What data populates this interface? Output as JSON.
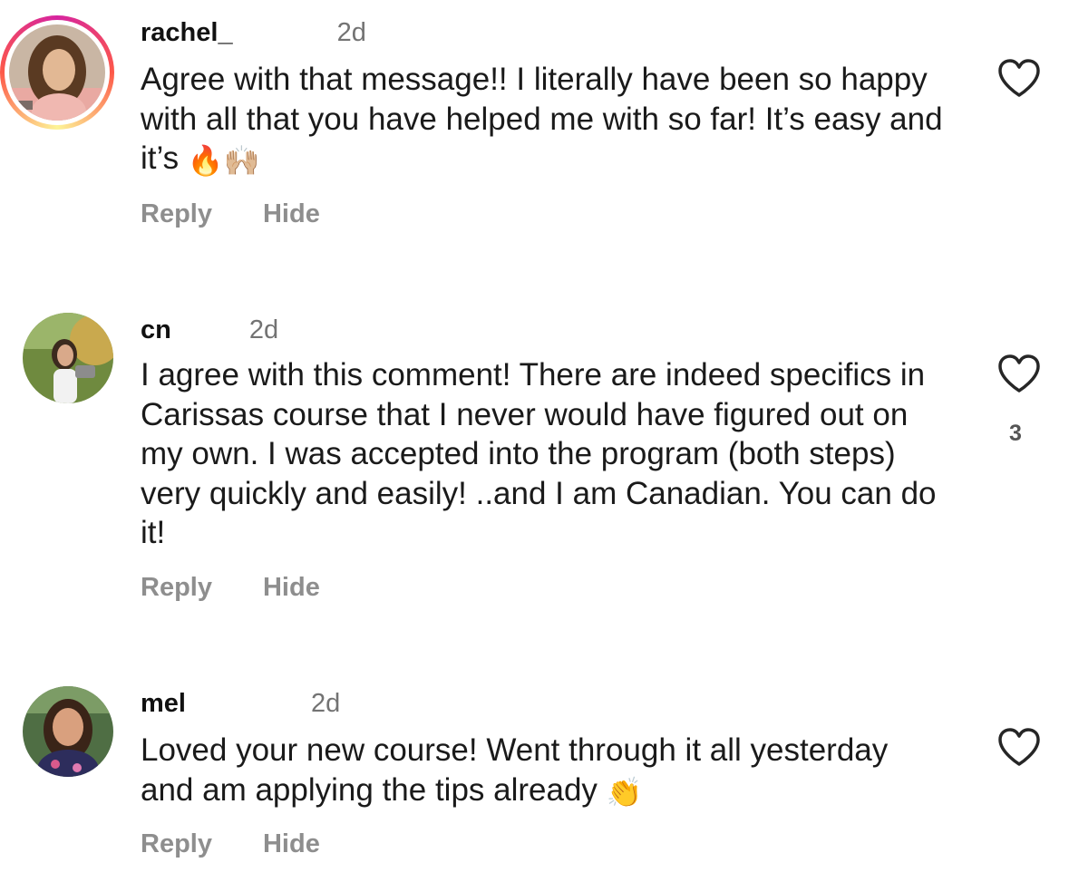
{
  "comments": [
    {
      "username_start": "rachel_",
      "username_end": "",
      "time": "2d",
      "text": "Agree with that message!! I literally have been so happy with all that you have helped me with so far! It’s easy and it’s",
      "emojis": "🔥🙌🏼",
      "reply_label": "Reply",
      "hide_label": "Hide",
      "likes": ""
    },
    {
      "username_start": "cn",
      "username_end": "",
      "time": "2d",
      "text": "I agree with this comment! There are indeed specifics in Carissas course that I never would have figured out on my own. I was accepted into the program (both steps) very quickly and easily! ..and I am Canadian. You can do it!",
      "emojis": "",
      "reply_label": "Reply",
      "hide_label": "Hide",
      "likes": "3"
    },
    {
      "username_start": "mel",
      "username_end": "",
      "time": "2d",
      "text": "Loved your new course! Went through it all yesterday and am applying the tips already",
      "emojis": "👏",
      "reply_label": "Reply",
      "hide_label": "Hide",
      "likes": ""
    }
  ],
  "colors": {
    "story_ring": "#d6249f",
    "secondary_text": "#737373",
    "action_text": "#8e8e8e"
  },
  "icons": [
    "heart-outline-icon",
    "avatar-photo"
  ]
}
